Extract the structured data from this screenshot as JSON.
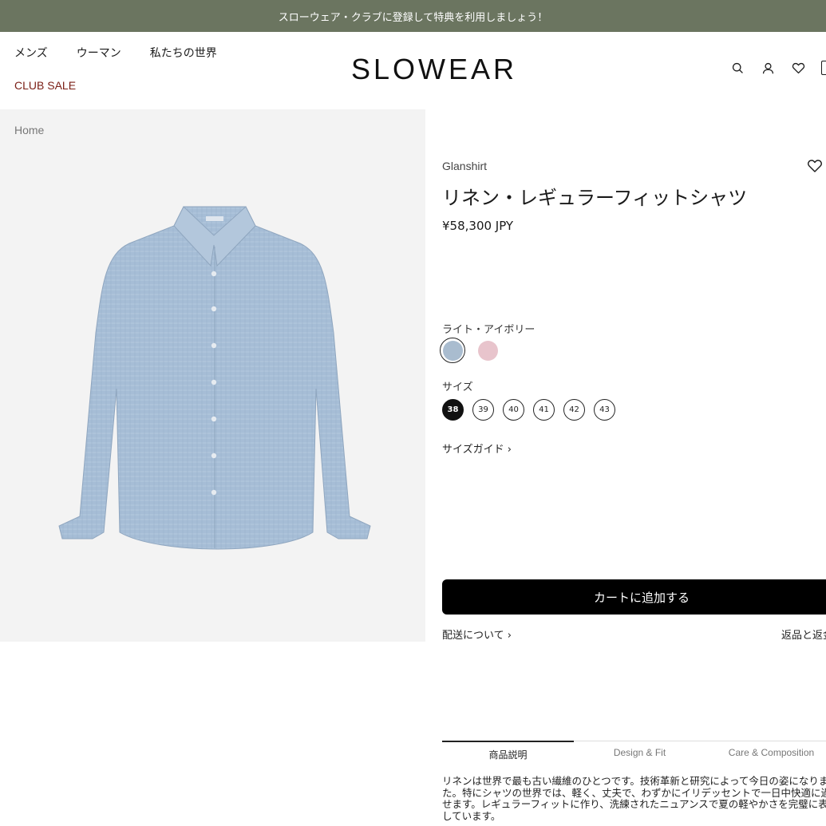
{
  "promo_banner": {
    "text": "スローウェア・クラブに登録して特典を利用しましょう！"
  },
  "header": {
    "nav": [
      "メンズ",
      "ウーマン",
      "私たちの世界"
    ],
    "club_sale": "CLUB SALE",
    "logo": "SLOWEAR",
    "icons": [
      "search-icon",
      "user-icon",
      "heart-icon",
      "cart-icon"
    ]
  },
  "breadcrumb": "Home",
  "product": {
    "brand": "Glanshirt",
    "title": "リネン・レギュラーフィットシャツ",
    "price": "¥58,300 JPY",
    "color_label": "ライト・アイボリー",
    "swatches": [
      {
        "name": "light-blue",
        "color": "#a9bccf",
        "selected": true
      },
      {
        "name": "pink",
        "color": "#e8c4cc",
        "selected": false
      }
    ],
    "size_label": "サイズ",
    "sizes": [
      "38",
      "39",
      "40",
      "41",
      "42",
      "43"
    ],
    "selected_size": "38",
    "size_guide": "サイズガイド ›",
    "add_to_cart": "カートに追加する",
    "shipping_link": "配送について ›",
    "returns_link": "返品と返金"
  },
  "tabs": [
    {
      "label": "商品説明",
      "active": true
    },
    {
      "label": "Design & Fit",
      "active": false
    },
    {
      "label": "Care & Composition",
      "active": false
    }
  ],
  "description": "リネンは世界で最も古い繊維のひとつです。技術革新と研究によって今日の姿になりました。特にシャツの世界では、軽く、丈夫で、わずかにイリデッセントで一日中快適に過ごせます。レギュラーフィットに作り、洗練されたニュアンスで夏の軽やかさを完璧に表現しています。",
  "colors": {
    "promo_bg": "#6b7560",
    "club_sale": "#7a1d14",
    "button_bg": "#000000"
  }
}
